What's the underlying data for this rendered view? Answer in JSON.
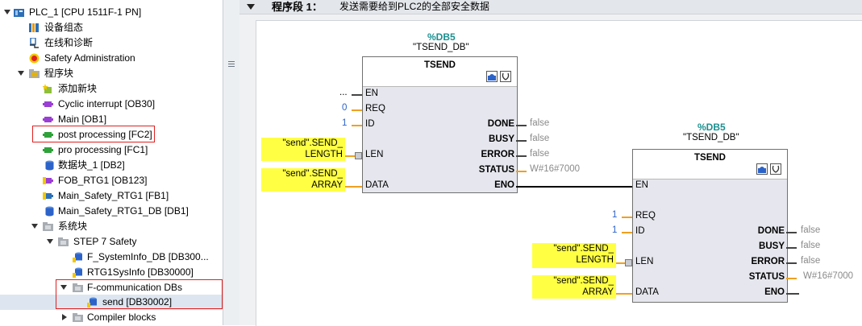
{
  "tree": {
    "items": [
      {
        "label": "PLC_1 [CPU 1511F-1 PN]",
        "icon": "plc-icon"
      },
      {
        "label": "设备组态",
        "icon": "device-config-icon"
      },
      {
        "label": "在线和诊断",
        "icon": "online-diagnostics-icon"
      },
      {
        "label": "Safety Administration",
        "icon": "safety-admin-icon"
      },
      {
        "label": "程序块",
        "icon": "folder-icon"
      },
      {
        "label": "添加新块",
        "icon": "add-block-icon"
      },
      {
        "label": "Cyclic interrupt [OB30]",
        "icon": "ob-block-icon"
      },
      {
        "label": "Main [OB1]",
        "icon": "ob-block-icon"
      },
      {
        "label": "post processing [FC2]",
        "icon": "fc-block-icon"
      },
      {
        "label": "pro processing [FC1]",
        "icon": "fc-block-icon"
      },
      {
        "label": "数据块_1 [DB2]",
        "icon": "db-icon"
      },
      {
        "label": "FOB_RTG1 [OB123]",
        "icon": "safety-ob-icon"
      },
      {
        "label": "Main_Safety_RTG1 [FB1]",
        "icon": "safety-fb-icon"
      },
      {
        "label": "Main_Safety_RTG1_DB [DB1]",
        "icon": "db-icon"
      },
      {
        "label": "系统块",
        "icon": "folder-icon"
      },
      {
        "label": "STEP 7 Safety",
        "icon": "folder-icon"
      },
      {
        "label": "F_SystemInfo_DB [DB300...",
        "icon": "safety-db-icon"
      },
      {
        "label": "RTG1SysInfo [DB30000]",
        "icon": "safety-db-icon"
      },
      {
        "label": "F-communication DBs",
        "icon": "folder-icon"
      },
      {
        "label": "send [DB30002]",
        "icon": "safety-db-icon"
      },
      {
        "label": "Compiler blocks",
        "icon": "folder-icon"
      }
    ]
  },
  "network": {
    "title": "程序段 1：",
    "comment": "发送需要给到PLC2的全部安全数据"
  },
  "block1": {
    "db_tag": "%DB5",
    "db_name": "\"TSEND_DB\"",
    "type": "TSEND",
    "inputs": {
      "en": "EN",
      "en_val": "...",
      "req": "REQ",
      "req_val": "0",
      "id": "ID",
      "id_val": "1",
      "len": "LEN",
      "len_val_1": "\"send\".SEND_",
      "len_val_2": "LENGTH",
      "data": "DATA",
      "data_val_1": "\"send\".SEND_",
      "data_val_2": "ARRAY"
    },
    "outputs": {
      "done": "DONE",
      "done_val": "false",
      "busy": "BUSY",
      "busy_val": "false",
      "error": "ERROR",
      "error_val": "false",
      "status": "STATUS",
      "status_val": "W#16#7000",
      "eno": "ENO"
    }
  },
  "block2": {
    "db_tag": "%DB5",
    "db_name": "\"TSEND_DB\"",
    "type": "TSEND",
    "inputs": {
      "en": "EN",
      "req": "REQ",
      "req_val": "1",
      "id": "ID",
      "id_val": "1",
      "len": "LEN",
      "len_val_1": "\"send\".SEND_",
      "len_val_2": "LENGTH",
      "data": "DATA",
      "data_val_1": "\"send\".SEND_",
      "data_val_2": "ARRAY"
    },
    "outputs": {
      "done": "DONE",
      "done_val": "false",
      "busy": "BUSY",
      "busy_val": "false",
      "error": "ERROR",
      "error_val": "false",
      "status": "STATUS",
      "status_val": "W#16#7000",
      "eno": "ENO"
    }
  },
  "colors": {
    "tag": "#1a8f8f",
    "highlight": "#ffff44",
    "wire_orange": "#f0a020",
    "red_box": "#e02020"
  }
}
